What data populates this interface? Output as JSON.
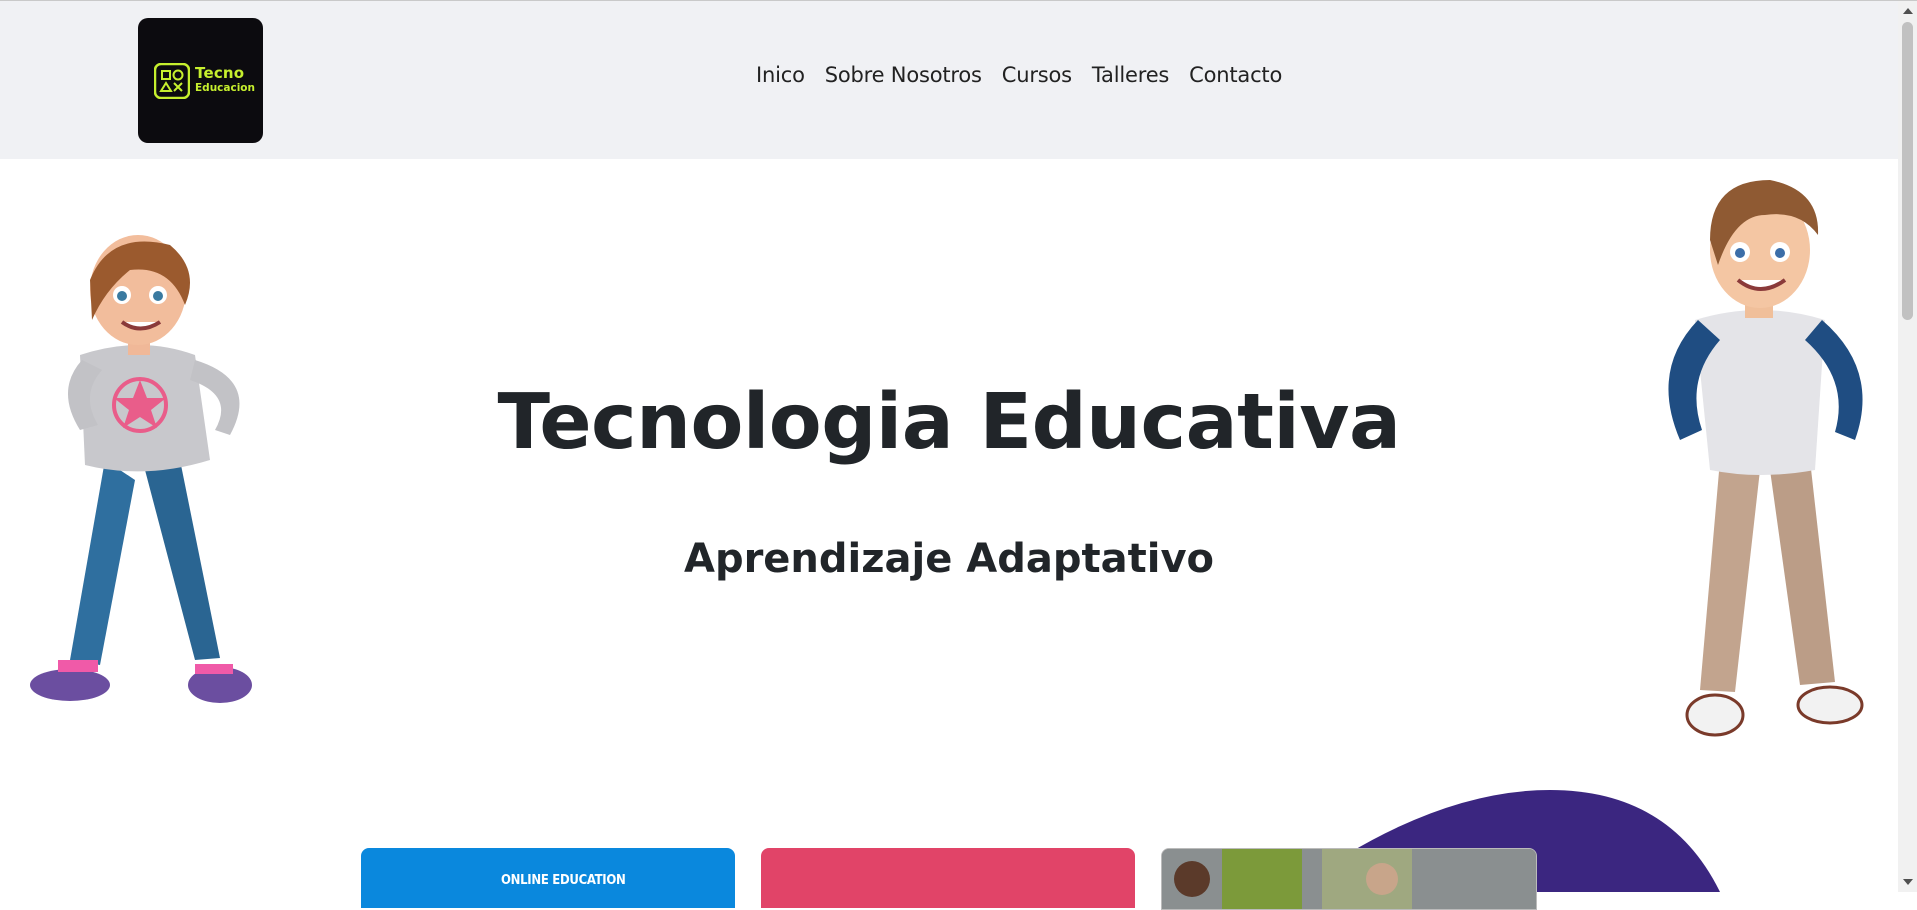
{
  "logo": {
    "title": "Tecno",
    "subtitle": "Educacion"
  },
  "nav": {
    "items": [
      "Inico",
      "Sobre Nosotros",
      "Cursos",
      "Talleres",
      "Contacto"
    ]
  },
  "hero": {
    "title": "Tecnologia Educativa",
    "subtitle": "Aprendizaje Adaptativo"
  },
  "cards": [
    {
      "label": "ONLINE EDUCATION",
      "color": "#0a88dd"
    },
    {
      "label": "",
      "color": "#e14468"
    },
    {
      "label": "",
      "color": "#7a7d80"
    }
  ],
  "colors": {
    "navbar_bg": "#f0f1f4",
    "logo_accent": "#c6ef2e",
    "blob": "#3b2680"
  }
}
